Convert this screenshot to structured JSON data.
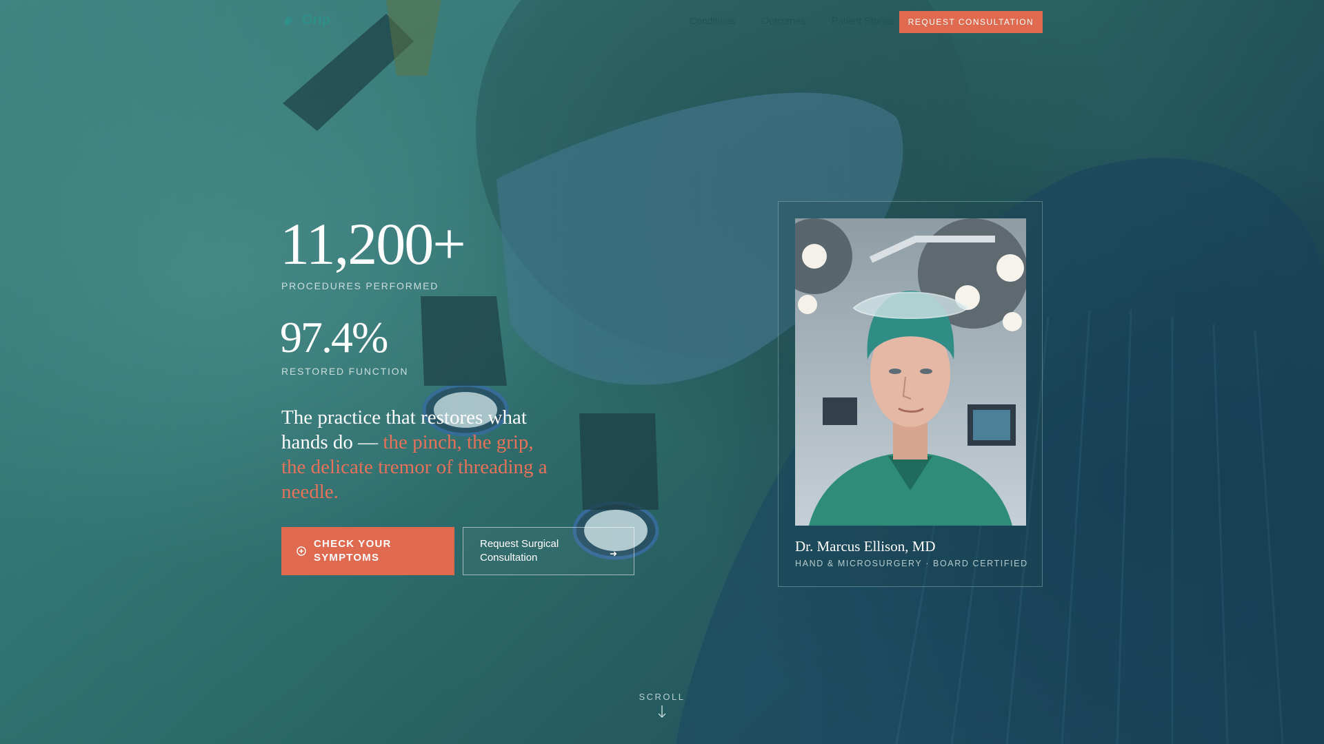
{
  "brand": {
    "name": "Grip",
    "icon": "hand-icon"
  },
  "nav": {
    "links": [
      "Conditions",
      "Outcomes",
      "Patient Stories"
    ],
    "cta_label": "REQUEST CONSULTATION"
  },
  "stats": [
    {
      "value": "11,200+",
      "label": "PROCEDURES PERFORMED"
    },
    {
      "value": "97.4%",
      "label": "RESTORED FUNCTION"
    }
  ],
  "tagline": {
    "lead": "The practice that restores what hands do — ",
    "accent": "the pinch, the grip, the delicate tremor of threading a needle."
  },
  "buttons": {
    "primary_label": "CHECK YOUR SYMPTOMS",
    "primary_icon": "plus-circle-icon",
    "secondary_label": "Request Surgical Consultation",
    "secondary_icon": "arrow-right-icon"
  },
  "surgeon": {
    "name": "Dr. Marcus Ellison, MD",
    "credentials": "HAND & MICROSURGERY · BOARD CERTIFIED"
  },
  "scroll": {
    "label": "SCROLL",
    "icon": "arrow-down-icon"
  },
  "colors": {
    "accent": "#e06a50",
    "teal": "#2f8f8a",
    "bg": "#2d6f6f"
  }
}
